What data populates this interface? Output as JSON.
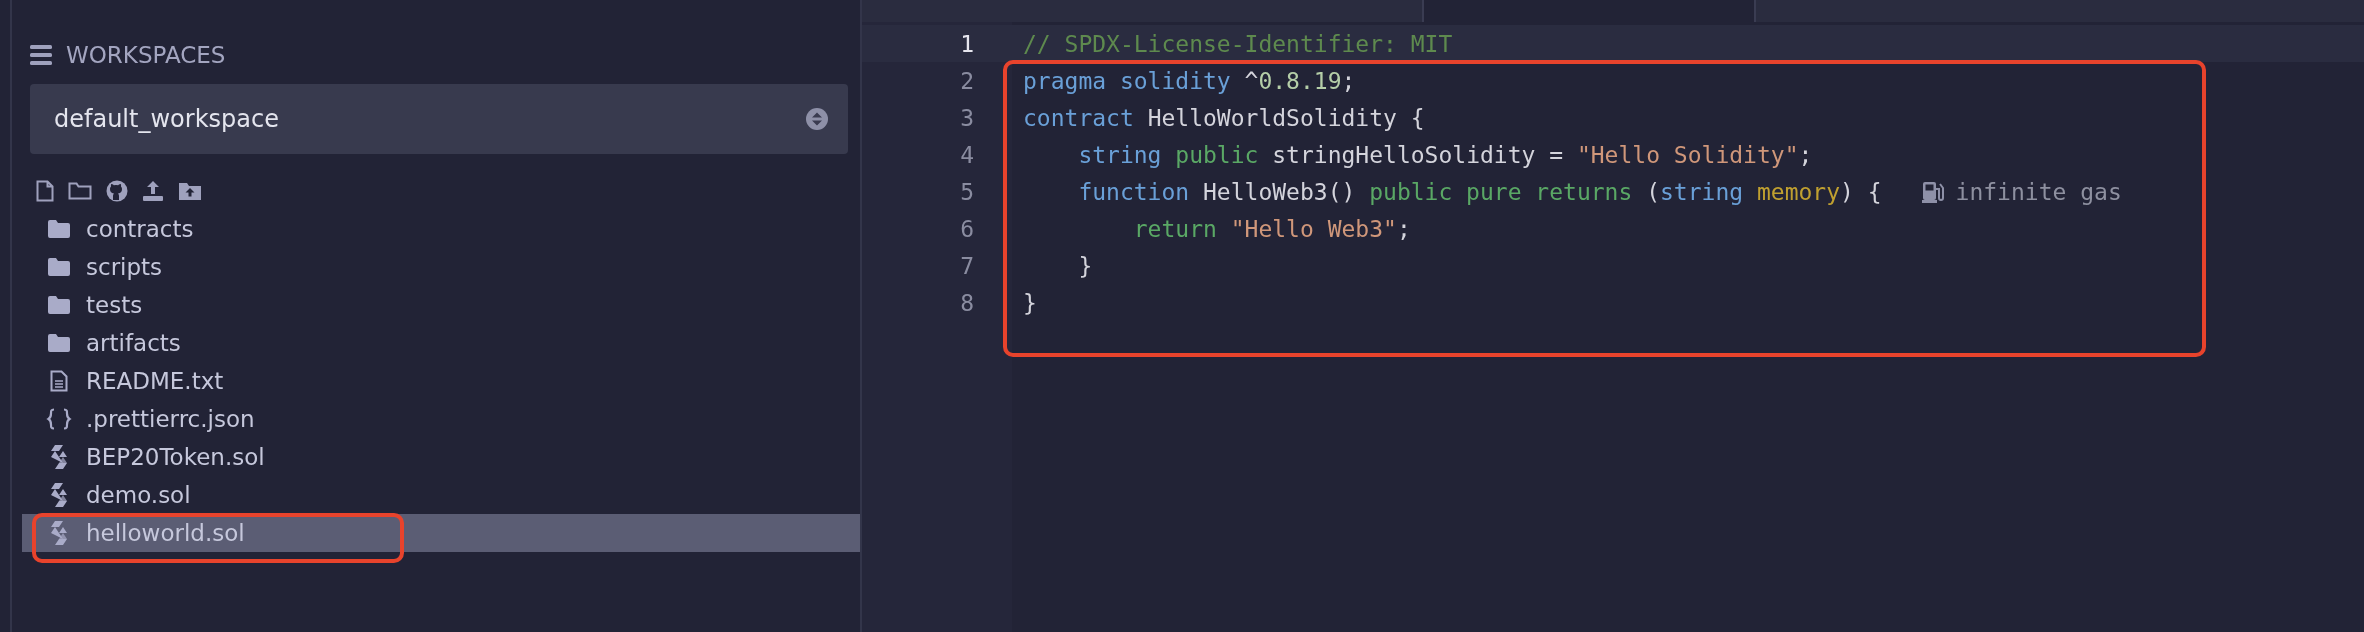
{
  "sidebar": {
    "section_title": "WORKSPACES",
    "workspace_select": {
      "value": "default_workspace"
    },
    "files": [
      {
        "name": "contracts",
        "kind": "folder",
        "selected": false,
        "annotated": false
      },
      {
        "name": "scripts",
        "kind": "folder",
        "selected": false,
        "annotated": false
      },
      {
        "name": "tests",
        "kind": "folder",
        "selected": false,
        "annotated": false
      },
      {
        "name": "artifacts",
        "kind": "folder",
        "selected": false,
        "annotated": false
      },
      {
        "name": "README.txt",
        "kind": "text",
        "selected": false,
        "annotated": false
      },
      {
        "name": ".prettierrc.json",
        "kind": "json",
        "selected": false,
        "annotated": false
      },
      {
        "name": "BEP20Token.sol",
        "kind": "solidity",
        "selected": false,
        "annotated": false
      },
      {
        "name": "demo.sol",
        "kind": "solidity",
        "selected": false,
        "annotated": false
      },
      {
        "name": "helloworld.sol",
        "kind": "solidity",
        "selected": true,
        "annotated": true
      }
    ]
  },
  "editor": {
    "annotated": true,
    "lines": [
      {
        "number": "1",
        "current": true,
        "tokens": [
          {
            "text": "// SPDX-License-Identifier: MIT",
            "kind": "comment"
          }
        ]
      },
      {
        "number": "2",
        "current": false,
        "tokens": [
          {
            "text": "pragma solidity",
            "kind": "keyword"
          },
          {
            "text": " ^",
            "kind": "plain"
          },
          {
            "text": "0.8.19",
            "kind": "number"
          },
          {
            "text": ";",
            "kind": "plain"
          }
        ]
      },
      {
        "number": "3",
        "current": false,
        "tokens": [
          {
            "text": "contract",
            "kind": "keyword"
          },
          {
            "text": " HelloWorldSolidity {",
            "kind": "plain"
          }
        ]
      },
      {
        "number": "4",
        "current": false,
        "tokens": [
          {
            "text": "    string",
            "kind": "keyword"
          },
          {
            "text": " public",
            "kind": "modifier"
          },
          {
            "text": " stringHelloSolidity = ",
            "kind": "plain"
          },
          {
            "text": "\"Hello Solidity\"",
            "kind": "string"
          },
          {
            "text": ";",
            "kind": "plain"
          }
        ]
      },
      {
        "number": "5",
        "current": false,
        "hint": "infinite gas",
        "tokens": [
          {
            "text": "    function",
            "kind": "keyword"
          },
          {
            "text": " HelloWeb3() ",
            "kind": "plain"
          },
          {
            "text": "public pure returns",
            "kind": "modifier"
          },
          {
            "text": " (",
            "kind": "plain"
          },
          {
            "text": "string",
            "kind": "keyword"
          },
          {
            "text": " memory",
            "kind": "storage"
          },
          {
            "text": ") {",
            "kind": "plain"
          }
        ]
      },
      {
        "number": "6",
        "current": false,
        "tokens": [
          {
            "text": "        return",
            "kind": "modifier"
          },
          {
            "text": " \"Hello Web3\"",
            "kind": "string"
          },
          {
            "text": ";",
            "kind": "plain"
          }
        ]
      },
      {
        "number": "7",
        "current": false,
        "tokens": [
          {
            "text": "    }",
            "kind": "plain"
          }
        ]
      },
      {
        "number": "8",
        "current": false,
        "tokens": [
          {
            "text": "}",
            "kind": "plain"
          }
        ]
      }
    ]
  }
}
